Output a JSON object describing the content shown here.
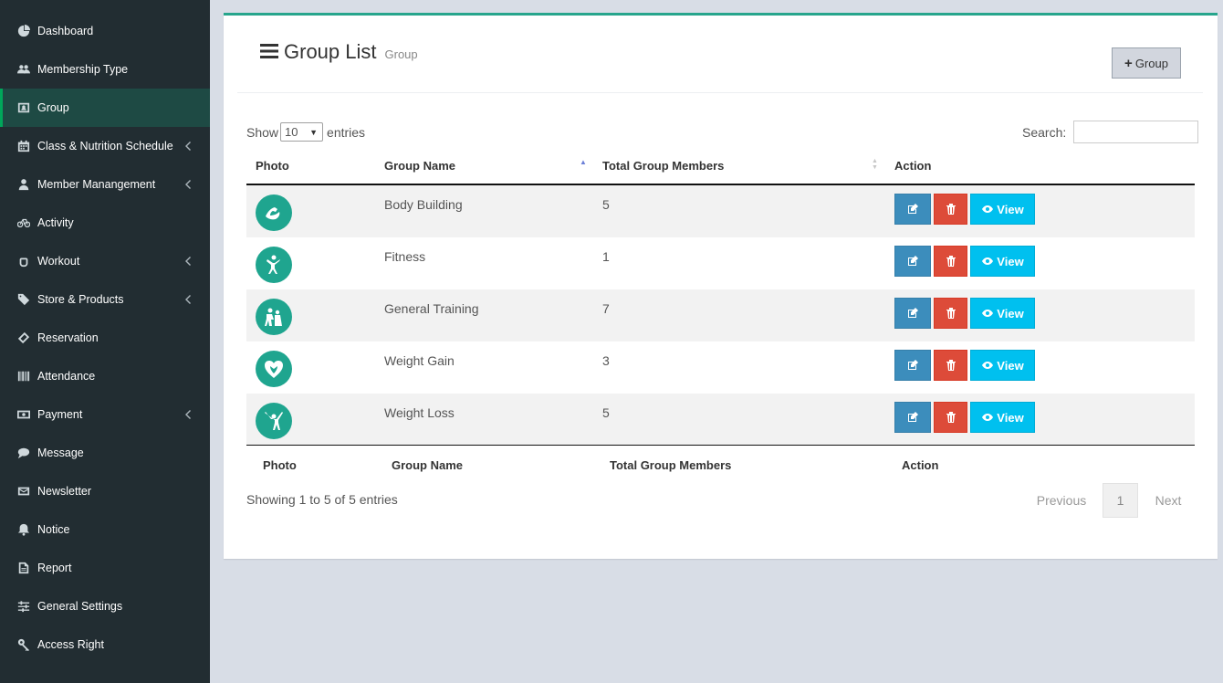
{
  "sidebar": {
    "items": [
      {
        "label": "Dashboard",
        "icon": "dashboard-icon",
        "has_submenu": false,
        "active": false
      },
      {
        "label": "Membership Type",
        "icon": "users-icon",
        "has_submenu": false,
        "active": false
      },
      {
        "label": "Group",
        "icon": "group-icon",
        "has_submenu": false,
        "active": true
      },
      {
        "label": "Class & Nutrition Schedule",
        "icon": "calendar-icon",
        "has_submenu": true,
        "active": false
      },
      {
        "label": "Member Manangement",
        "icon": "user-icon",
        "has_submenu": true,
        "active": false
      },
      {
        "label": "Activity",
        "icon": "bicycle-icon",
        "has_submenu": false,
        "active": false
      },
      {
        "label": "Workout",
        "icon": "hand-icon",
        "has_submenu": true,
        "active": false
      },
      {
        "label": "Store & Products",
        "icon": "tags-icon",
        "has_submenu": true,
        "active": false
      },
      {
        "label": "Reservation",
        "icon": "ticket-icon",
        "has_submenu": false,
        "active": false
      },
      {
        "label": "Attendance",
        "icon": "barcode-icon",
        "has_submenu": false,
        "active": false
      },
      {
        "label": "Payment",
        "icon": "money-icon",
        "has_submenu": true,
        "active": false
      },
      {
        "label": "Message",
        "icon": "comment-icon",
        "has_submenu": false,
        "active": false
      },
      {
        "label": "Newsletter",
        "icon": "envelope-icon",
        "has_submenu": false,
        "active": false
      },
      {
        "label": "Notice",
        "icon": "bell-icon",
        "has_submenu": false,
        "active": false
      },
      {
        "label": "Report",
        "icon": "file-icon",
        "has_submenu": false,
        "active": false
      },
      {
        "label": "General Settings",
        "icon": "sliders-icon",
        "has_submenu": false,
        "active": false
      },
      {
        "label": "Access Right",
        "icon": "key-icon",
        "has_submenu": false,
        "active": false
      }
    ]
  },
  "header": {
    "title": "Group List",
    "subtitle": "Group",
    "add_button_label": "Group"
  },
  "controls": {
    "show_label": "Show",
    "entries_value": "10",
    "entries_label": "entries",
    "search_label": "Search:"
  },
  "table": {
    "columns": [
      "Photo",
      "Group Name",
      "Total Group Members",
      "Action"
    ],
    "rows": [
      {
        "name": "Body Building",
        "members": "5",
        "icon": "bodybuilding-icon"
      },
      {
        "name": "Fitness",
        "members": "1",
        "icon": "fitness-icon"
      },
      {
        "name": "General Training",
        "members": "7",
        "icon": "training-icon"
      },
      {
        "name": "Weight Gain",
        "members": "3",
        "icon": "weight-gain-icon"
      },
      {
        "name": "Weight Loss",
        "members": "5",
        "icon": "weight-loss-icon"
      }
    ],
    "view_label": "View"
  },
  "footer": {
    "info": "Showing 1 to 5 of 5 entries",
    "previous": "Previous",
    "page": "1",
    "next": "Next"
  },
  "colors": {
    "sidebar_bg": "#222d32",
    "accent": "#27a58c",
    "edit": "#3c8dbc",
    "delete": "#dd4b39",
    "view": "#00c0ef"
  }
}
